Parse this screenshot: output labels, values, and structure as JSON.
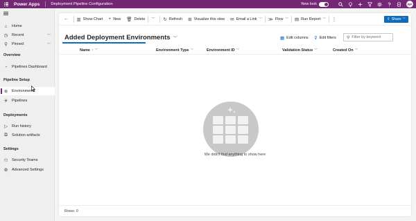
{
  "topbar": {
    "brand": "Power Apps",
    "app_title": "Deployment Pipeline Configuration",
    "new_look_label": "New look",
    "new_look_on": true,
    "avatar_initials": "RP",
    "icons": [
      "search-icon",
      "lightbulb-icon",
      "add-icon",
      "filter-icon",
      "gear-icon",
      "help-icon",
      "copilot-icon"
    ]
  },
  "sidebar": {
    "top_items": [
      {
        "label": "Home",
        "icon": "home-icon"
      },
      {
        "label": "Recent",
        "icon": "clock-icon",
        "expandable": true
      },
      {
        "label": "Pinned",
        "icon": "pin-icon",
        "expandable": true
      }
    ],
    "sections": [
      {
        "title": "Overview",
        "items": [
          {
            "label": "Pipelines Dashboard",
            "icon": "dashboard-icon"
          }
        ]
      },
      {
        "title": "Pipeline Setup",
        "items": [
          {
            "label": "Environments",
            "icon": "environment-icon",
            "active": true
          },
          {
            "label": "Pipelines",
            "icon": "rocket-icon"
          }
        ]
      },
      {
        "title": "Deployments",
        "items": [
          {
            "label": "Run history",
            "icon": "play-icon"
          },
          {
            "label": "Solution artifacts",
            "icon": "artifact-icon"
          }
        ]
      },
      {
        "title": "Settings",
        "items": [
          {
            "label": "Security Teams",
            "icon": "people-icon"
          },
          {
            "label": "Advanced Settings",
            "icon": "settings-icon"
          }
        ]
      }
    ]
  },
  "commandbar": {
    "show_chart": "Show Chart",
    "new": "New",
    "delete": "Delete",
    "refresh": "Refresh",
    "visualize": "Visualize this view",
    "email_link": "Email a Link",
    "flow": "Flow",
    "run_report": "Run Report",
    "share": "Share"
  },
  "view": {
    "title": "Added Deployment Environments",
    "edit_columns": "Edit columns",
    "edit_filters": "Edit filters",
    "filter_placeholder": "Filter by keyword"
  },
  "grid": {
    "columns": [
      {
        "label": "Name",
        "sort": "ascending"
      },
      {
        "label": "Environment Type"
      },
      {
        "label": "Environment ID"
      },
      {
        "label": "Validation Status"
      },
      {
        "label": "Created On"
      }
    ],
    "empty_message": "We didn't find anything to show here",
    "rows_label": "Rows: 0"
  },
  "colors": {
    "brand": "#742774",
    "accent": "#0f6cbd"
  }
}
